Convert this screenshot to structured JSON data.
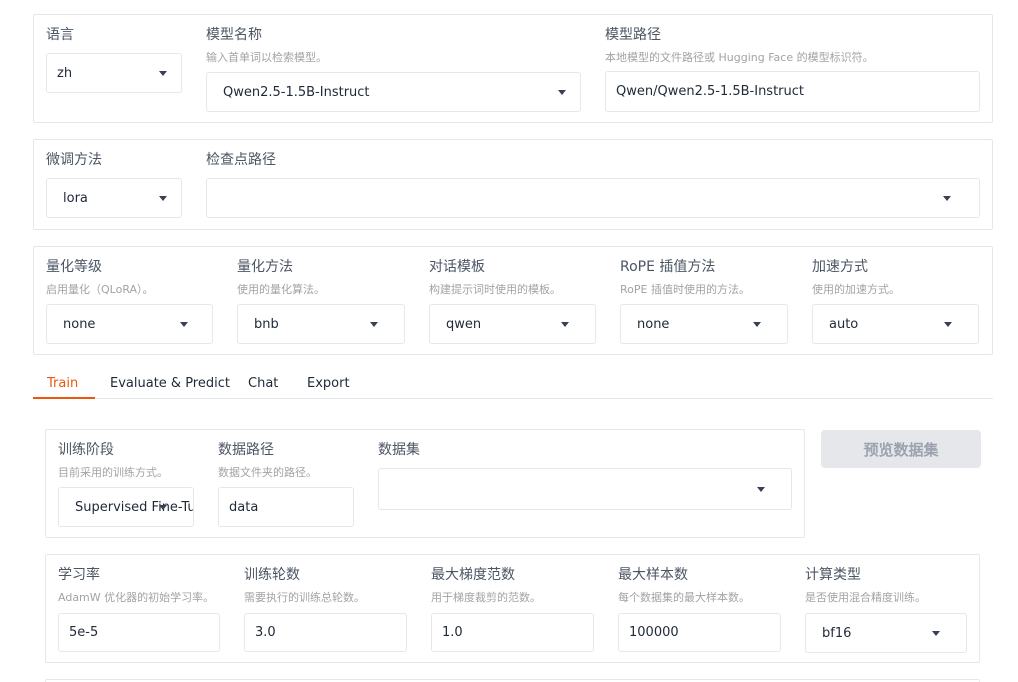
{
  "model_panel": {
    "lang": {
      "label": "语言",
      "value": "zh"
    },
    "model_name": {
      "label": "模型名称",
      "hint": "输入首单词以检索模型。",
      "value": "Qwen2.5-1.5B-Instruct"
    },
    "model_path": {
      "label": "模型路径",
      "hint": "本地模型的文件路径或 Hugging Face 的模型标识符。",
      "value": "Qwen/Qwen2.5-1.5B-Instruct"
    }
  },
  "finetune_panel": {
    "method": {
      "label": "微调方法",
      "value": "lora"
    },
    "checkpoint": {
      "label": "检查点路径",
      "value": ""
    }
  },
  "advanced_panel": {
    "quant_bit": {
      "label": "量化等级",
      "hint": "启用量化（QLoRA）。",
      "value": "none"
    },
    "quant_method": {
      "label": "量化方法",
      "hint": "使用的量化算法。",
      "value": "bnb"
    },
    "template": {
      "label": "对话模板",
      "hint": "构建提示词时使用的模板。",
      "value": "qwen"
    },
    "rope": {
      "label": "RoPE 插值方法",
      "hint": "RoPE 插值时使用的方法。",
      "value": "none"
    },
    "booster": {
      "label": "加速方式",
      "hint": "使用的加速方式。",
      "value": "auto"
    }
  },
  "tabs": [
    "Train",
    "Evaluate & Predict",
    "Chat",
    "Export"
  ],
  "train_panel": {
    "stage": {
      "label": "训练阶段",
      "hint": "目前采用的训练方式。",
      "value": "Supervised Fine-Tuning"
    },
    "dataset_dir": {
      "label": "数据路径",
      "hint": "数据文件夹的路径。",
      "value": "data"
    },
    "dataset": {
      "label": "数据集",
      "value": ""
    },
    "preview_button": "预览数据集"
  },
  "params_panel": {
    "lr": {
      "label": "学习率",
      "hint": "AdamW 优化器的初始学习率。",
      "value": "5e-5"
    },
    "epochs": {
      "label": "训练轮数",
      "hint": "需要执行的训练总轮数。",
      "value": "3.0"
    },
    "max_grad_norm": {
      "label": "最大梯度范数",
      "hint": "用于梯度裁剪的范数。",
      "value": "1.0"
    },
    "max_samples": {
      "label": "最大样本数",
      "hint": "每个数据集的最大样本数。",
      "value": "100000"
    },
    "compute_type": {
      "label": "计算类型",
      "hint": "是否使用混合精度训练。",
      "value": "bf16"
    }
  },
  "colors": {
    "accent": "#ea580c",
    "border": "#e5e7eb",
    "hint": "#a3a3a3"
  }
}
